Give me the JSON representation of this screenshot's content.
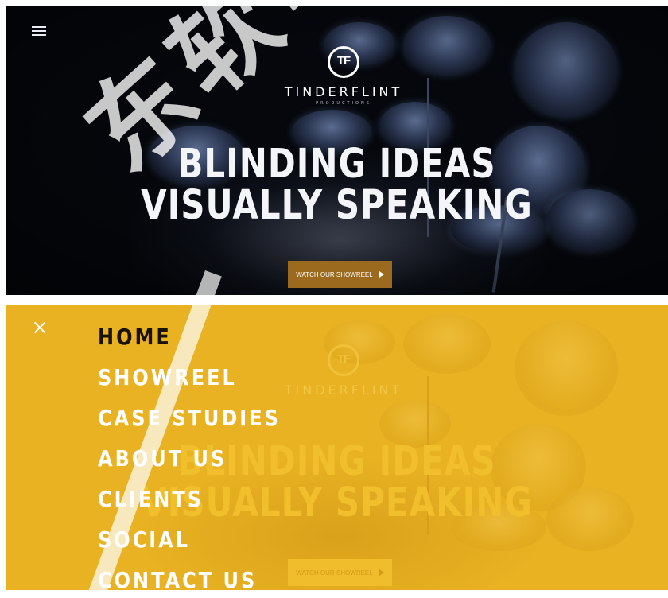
{
  "hero": {
    "logo_mark": "TF",
    "logo_word": "TINDERFLINT",
    "logo_sub": "PRODUCTIONS",
    "headline_line1": "BLINDING IDEAS",
    "headline_line2": "VISUALLY SPEAKING",
    "cta_label": "WATCH OUR SHOWREEL"
  },
  "nav": {
    "items": [
      {
        "label": "HOME",
        "active": true
      },
      {
        "label": "SHOWREEL",
        "active": false
      },
      {
        "label": "CASE STUDIES",
        "active": false
      },
      {
        "label": "ABOUT US",
        "active": false
      },
      {
        "label": "CLIENTS",
        "active": false
      },
      {
        "label": "SOCIAL",
        "active": false
      },
      {
        "label": "CONTACT US",
        "active": false
      }
    ]
  },
  "watermark": "东软电子",
  "colors": {
    "accent": "#e8b223",
    "cta": "#9b6a1f",
    "hero_bg": "#05070c"
  },
  "icons": {
    "menu": "hamburger-icon",
    "close": "close-icon",
    "play": "play-icon"
  }
}
